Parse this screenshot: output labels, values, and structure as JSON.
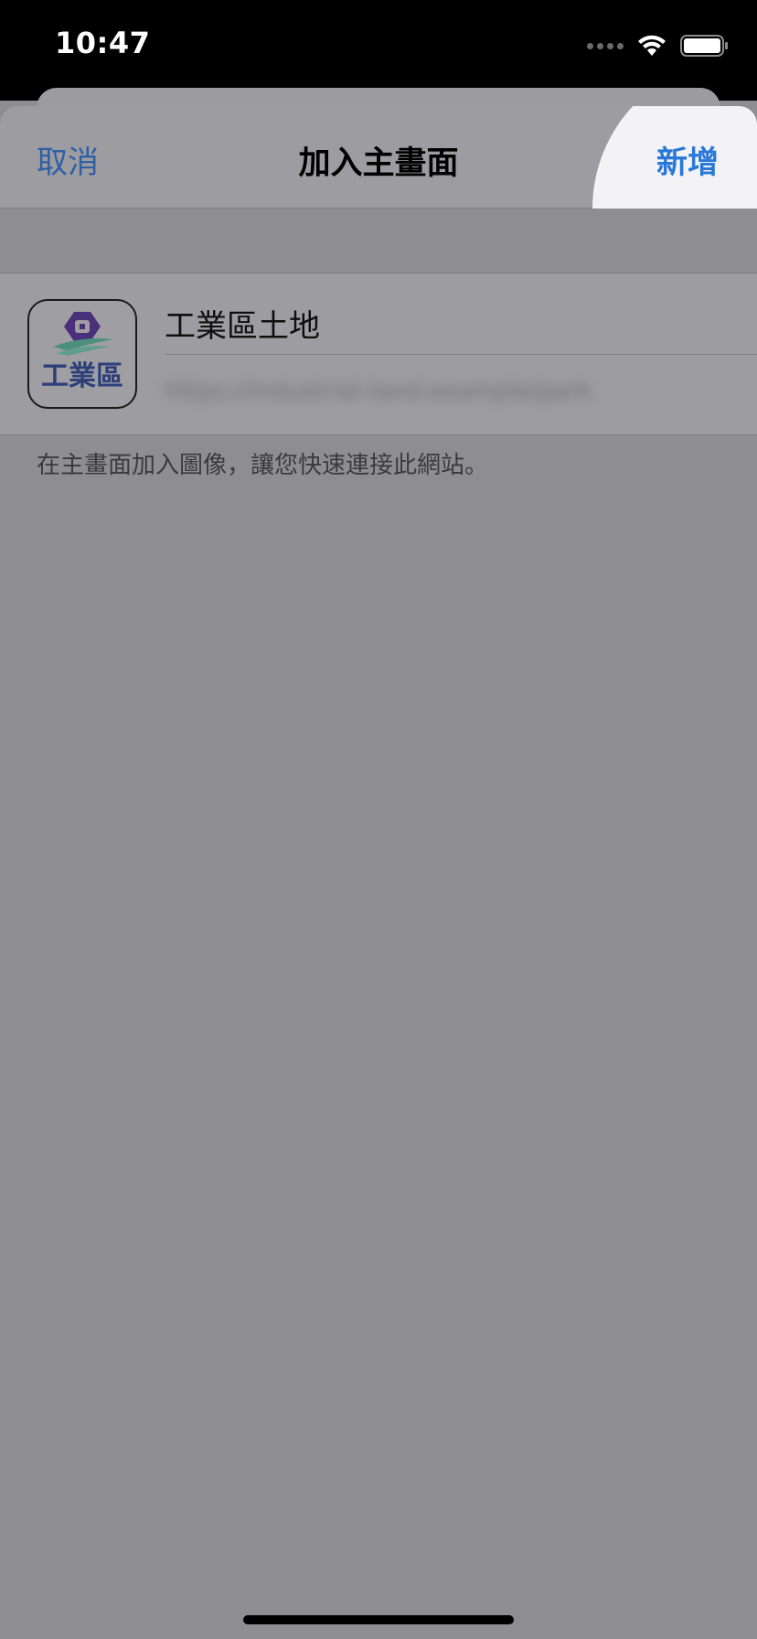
{
  "status_bar": {
    "time": "10:47",
    "icons": [
      "cellular-signal-icon",
      "wifi-icon",
      "battery-icon"
    ]
  },
  "navbar": {
    "cancel_label": "取消",
    "title": "加入主畫面",
    "add_label": "新增"
  },
  "app": {
    "icon_text": "工業區",
    "name": "工業區土地",
    "url": "https://industrial-land.example/park"
  },
  "hint_text": "在主畫面加入圖像，讓您快速連接此網站。",
  "colors": {
    "accent": "#2a78d8",
    "overlay": "#8e8d92",
    "icon_purple": "#4a2f7a",
    "icon_green": "#4c8f7c"
  }
}
